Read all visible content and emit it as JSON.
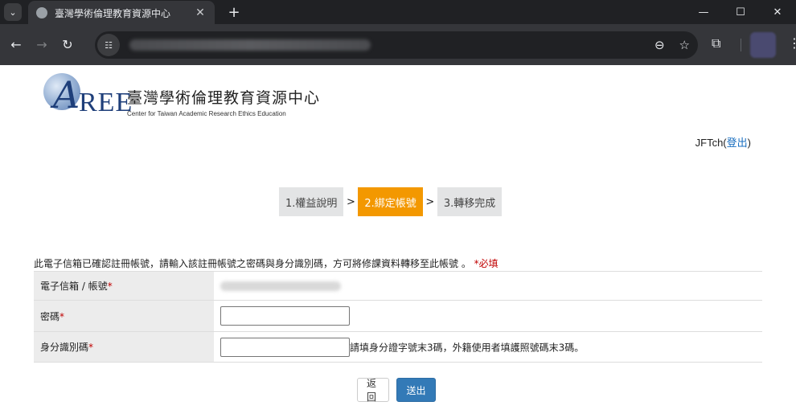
{
  "browser": {
    "tab_title": "臺灣學術倫理教育資源中心",
    "tab_close": "✕",
    "new_tab": "+",
    "tab_menu_icon": "chevron-down-icon",
    "window": {
      "minimize": "—",
      "maximize": "☐",
      "close": "✕"
    },
    "nav": {
      "back": "←",
      "forward": "→",
      "reload": "↻"
    },
    "site_info_icon": "tune-icon",
    "zoom_icon": "⊖",
    "star_icon": "☆",
    "extensions_icon": "⧉",
    "menu_icon": "⋮"
  },
  "header": {
    "logo_mark": "A",
    "logo_ree": "REE",
    "org_name_zh": "臺灣學術倫理教育資源中心",
    "org_name_en": "Center for Taiwan Academic Research Ethics Education",
    "username": "JFTch",
    "open_paren": "(",
    "logout_label": "登出",
    "close_paren": ")"
  },
  "steps": [
    {
      "label": "1.權益說明",
      "active": false
    },
    {
      "label": "2.綁定帳號",
      "active": true
    },
    {
      "label": "3.轉移完成",
      "active": false
    }
  ],
  "step_separator": ">",
  "form": {
    "notice": "此電子信箱已確認註冊帳號，請輸入該註冊帳號之密碼與身分識別碼，方可將修課資料轉移至此帳號 。",
    "required_note": "*必填",
    "email_label": "電子信箱 / 帳號",
    "password_label": "密碼",
    "id_label": "身分識別碼",
    "required_star": "*",
    "password_value": "",
    "id_value": "",
    "id_hint": "請填身分證字號末3碼，外籍使用者填護照號碼末3碼。"
  },
  "buttons": {
    "back_label": "返回",
    "submit_label": "送出"
  },
  "colors": {
    "active_step": "#f39800",
    "submit_button": "#337ab7",
    "required": "#c00000",
    "link": "#1a6fc0"
  }
}
